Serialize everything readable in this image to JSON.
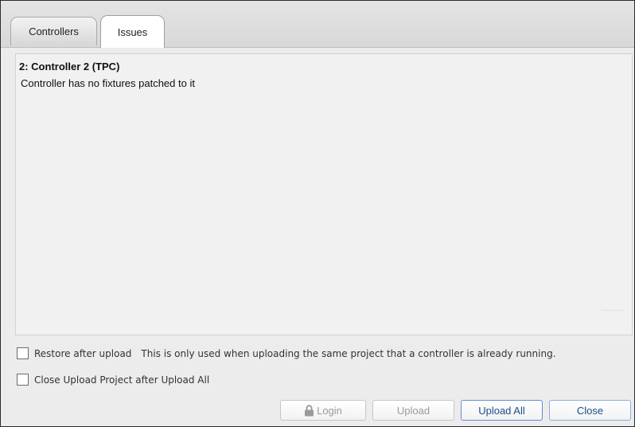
{
  "tabs": [
    {
      "label": "Controllers",
      "active": false
    },
    {
      "label": "Issues",
      "active": true
    }
  ],
  "issue": {
    "title": "2: Controller 2 (TPC)",
    "description": "Controller has no fixtures patched to it"
  },
  "options": {
    "restore_label": "Restore after upload",
    "restore_hint": "This is only used when uploading the same project that a controller is already running.",
    "close_label": "Close Upload Project after Upload All"
  },
  "buttons": {
    "login": "Login",
    "upload": "Upload",
    "upload_all": "Upload All",
    "close": "Close"
  },
  "colors": {
    "accent_border": "#5f8fd1",
    "accent_text": "#1d4c8e"
  },
  "icons": {
    "login": "lock-icon"
  }
}
